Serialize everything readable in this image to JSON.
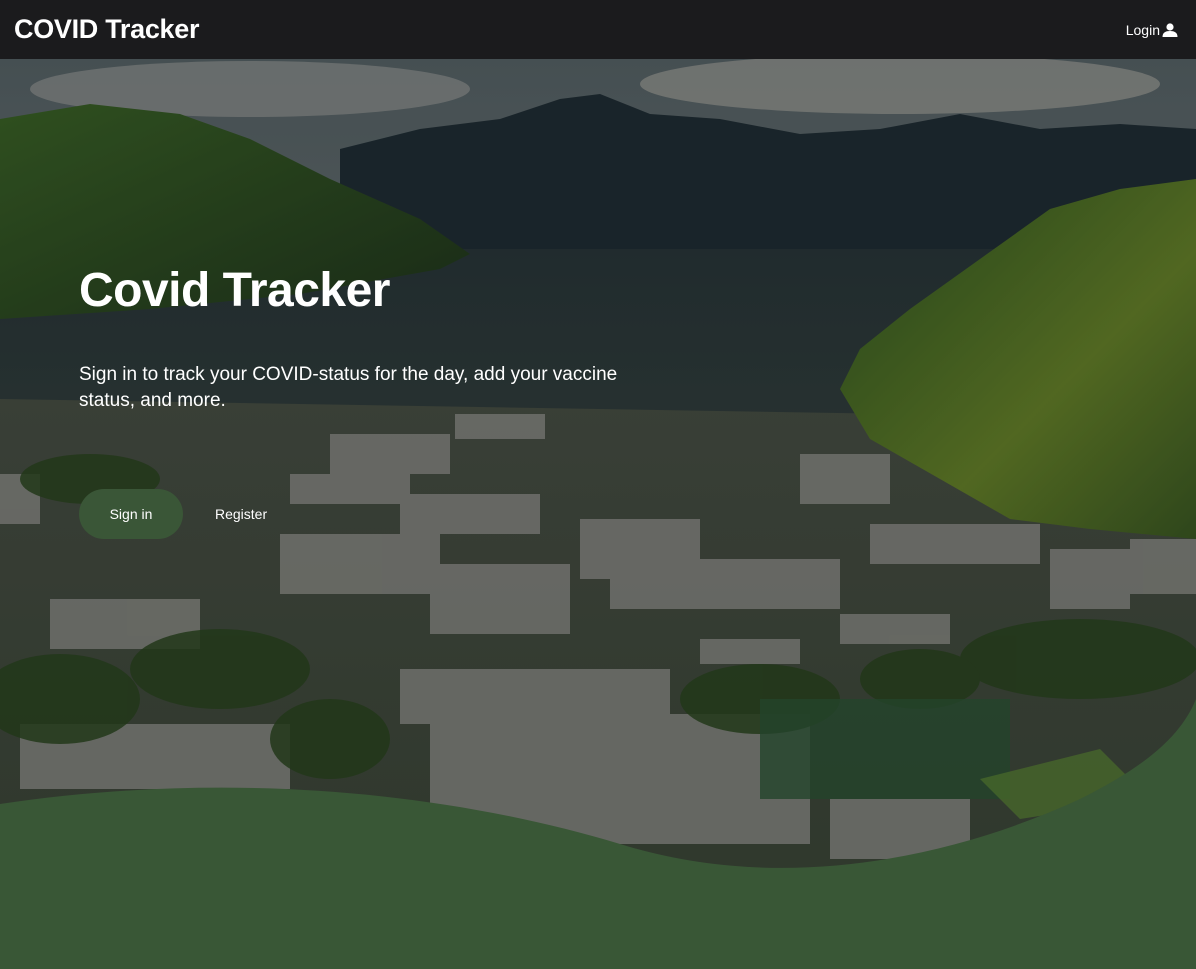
{
  "navbar": {
    "brand": "COVID Tracker",
    "login_label": "Login",
    "login_icon": "user-icon"
  },
  "hero": {
    "title": "Covid Tracker",
    "subtitle": "Sign in to track your COVID-status for the day, add your vaccine status, and more.",
    "signin_label": "Sign in",
    "register_label": "Register",
    "background": "aerial photo of a university campus in a green mountain valley"
  },
  "colors": {
    "navbar_bg": "#1b1b1d",
    "accent_green": "#395736",
    "text": "#ffffff"
  }
}
